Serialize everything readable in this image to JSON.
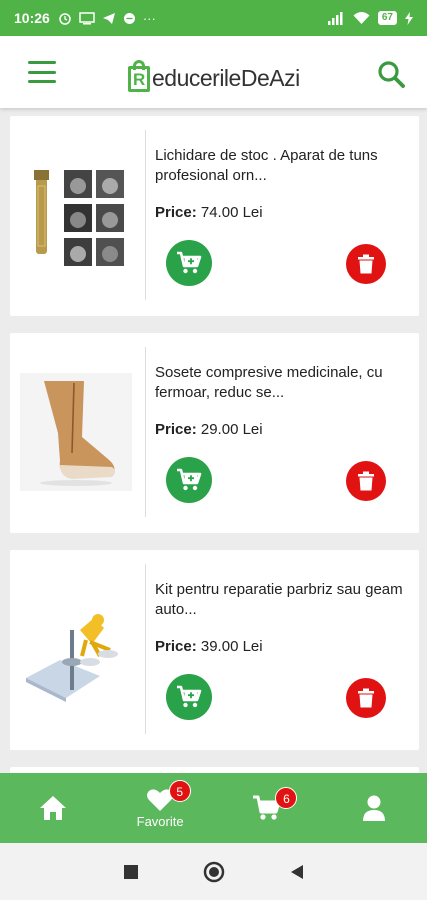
{
  "status_bar": {
    "time": "10:26",
    "battery": "67",
    "dots": "···"
  },
  "header": {
    "logo_letter": "R",
    "logo_text": "educerileDeAzi"
  },
  "products": [
    {
      "title": "Lichidare de stoc . Aparat de tuns profesional orn...",
      "price_label": "Price:",
      "price_value": " 74.00 Lei"
    },
    {
      "title": "Sosete compresive medicinale, cu fermoar, reduc se...",
      "price_label": "Price:",
      "price_value": " 29.00 Lei"
    },
    {
      "title": "Kit pentru reparatie parbriz sau geam auto...",
      "price_label": "Price:",
      "price_value": " 39.00 Lei"
    }
  ],
  "bottom_nav": {
    "home": "",
    "favorites_label": "Favorite",
    "favorites_count": "5",
    "cart_count": "6",
    "account": ""
  },
  "colors": {
    "brand_green": "#4fb348",
    "cart_button": "#2aa24a",
    "delete_button": "#e01212",
    "nav_green": "#5cb85c"
  }
}
